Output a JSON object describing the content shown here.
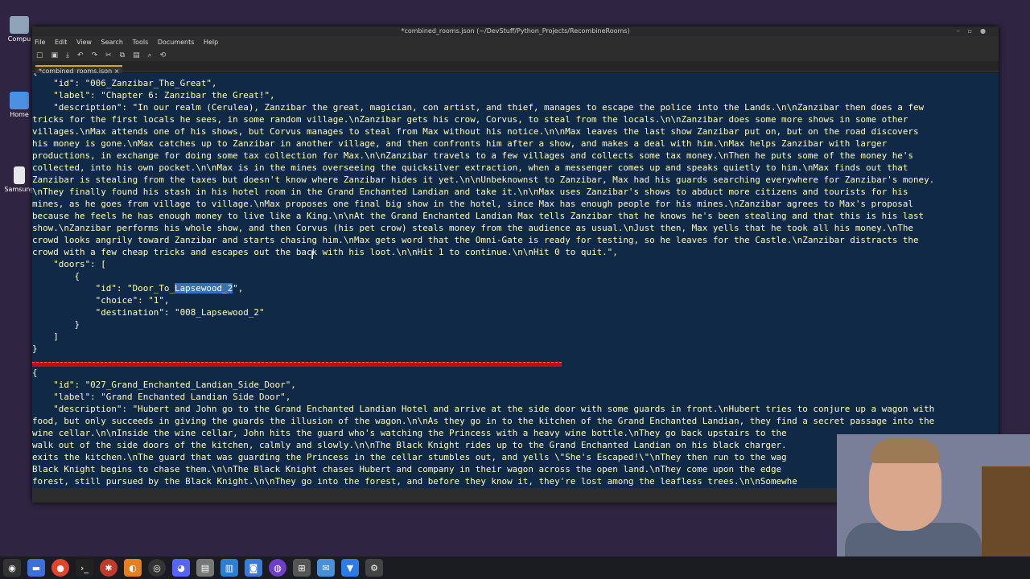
{
  "desktop": {
    "icons": [
      "Compu",
      "Home",
      "Samsung"
    ]
  },
  "window": {
    "title": "*combined_rooms.json (~/DevStuff/Python_Projects/RecombineRooms)",
    "menus": [
      "File",
      "Edit",
      "View",
      "Search",
      "Tools",
      "Documents",
      "Help"
    ],
    "tab_label": "*combined_rooms.json",
    "tab_close": "×"
  },
  "editor": {
    "l0": "{",
    "l1": "    \"id\": \"006_Zanzibar_The_Great\",",
    "l2": "    \"label\": \"Chapter 6: Zanzibar the Great!\",",
    "l3": "    \"description\": \"In our realm (Cerulea), Zanzibar the great, magician, con artist, and thief, manages to escape the police into the Lands.\\n\\nZanzibar then does a few",
    "l4": "tricks for the first locals he sees, in some random village.\\nZanzibar gets his crow, Corvus, to steal from the locals.\\n\\nZanzibar does some more shows in some other",
    "l5": "villages.\\nMax attends one of his shows, but Corvus manages to steal from Max without his notice.\\n\\nMax leaves the last show Zanzibar put on, but on the road discovers",
    "l6": "his money is gone.\\nMax catches up to Zanzibar in another village, and then confronts him after a show, and makes a deal with him.\\nMax helps Zanzibar with larger",
    "l7": "productions, in exchange for doing some tax collection for Max.\\n\\nZanzibar travels to a few villages and collects some tax money.\\nThen he puts some of the money he's",
    "l8": "collected, into his own pocket.\\n\\nMax is in the mines overseeing the quicksilver extraction, when a messenger comes up and speaks quietly to him.\\nMax finds out that",
    "l9": "Zanzibar is stealing from the taxes but doesn't know where Zanzibar hides it yet.\\n\\nUnbeknownst to Zanzibar, Max had his guards searching everywhere for Zanzibar's money.",
    "l10": "\\nThey finally found his stash in his hotel room in the Grand Enchanted Landian and take it.\\n\\nMax uses Zanzibar's shows to abduct more citizens and tourists for his",
    "l11": "mines, as he goes from village to village.\\nMax proposes one final big show in the hotel, since Max has enough people for his mines.\\nZanzibar agrees to Max's proposal",
    "l12": "because he feels he has enough money to live like a King.\\n\\nAt the Grand Enchanted Landian Max tells Zanzibar that he knows he's been stealing and that this is his last",
    "l13": "show.\\nZanzibar performs his whole show, and then Corvus (his pet crow) steals money from the audience as usual.\\nJust then, Max yells that he took all his money.\\nThe",
    "l14": "crowd looks angrily toward Zanzibar and starts chasing him.\\nMax gets word that the Omni-Gate is ready for testing, so he leaves for the Castle.\\nZanzibar distracts the",
    "l15": "crowd with a few cheap tricks and escapes out the back with his loot.\\n\\nHit 1 to continue.\\n\\nHit 0 to quit.\",",
    "l16": "    \"doors\": [",
    "l17": "        {",
    "l18a": "            \"id\": \"Door_To_",
    "l18sel": "Lapsewood_2",
    "l18b": "\",",
    "l19": "            \"choice\": \"1\",",
    "l20": "            \"destination\": \"008_Lapsewood_2\"",
    "l21": "        }",
    "l22": "    ]",
    "l23": "}",
    "l24": "{",
    "l25": "    \"id\": \"027_Grand_Enchanted_Landian_Side_Door\",",
    "l26": "    \"label\": \"Grand Enchanted Landian Side Door\",",
    "l27": "    \"description\": \"Hubert and John go to the Grand Enchanted Landian Hotel and arrive at the side door with some guards in front.\\nHubert tries to conjure up a wagon with",
    "l28": "food, but only succeeds in giving the guards the illusion of the wagon.\\n\\nAs they go in to the kitchen of the Grand Enchanted Landian, they find a secret passage into the",
    "l29": "wine cellar.\\n\\nInside the wine cellar, John hits the guard who's watching the Princess with a heavy wine bottle.\\nThey go back upstairs to the",
    "l30": "walk out of the side doors of the kitchen, calmly and slowly.\\n\\nThe Black Knight rides up to the Grand Enchanted Landian on his black charger.",
    "l31": "exits the kitchen.\\nThe guard that was guarding the Princess in the cellar stumbles out, and yells \\\"She's Escaped!\\\"\\nThey then run to the wag",
    "l32": "Black Knight begins to chase them.\\n\\nThe Black Knight chases Hubert and company in their wagon across the open land.\\nThey come upon the edge",
    "l33": "forest, still pursued by the Black Knight.\\n\\nThey go into the forest, and before they know it, they're lost among the leafless trees.\\n\\nSomewhe"
  },
  "colors": {
    "editor_bg": "#0f2947",
    "text": "#fffdbf",
    "separator": "#c01010",
    "selection": "#3a6fb5"
  },
  "taskbar": {
    "icons": [
      "menu-icon",
      "folder-icon",
      "browser-icon",
      "terminal-icon",
      "game-icon",
      "blender-icon",
      "obs-icon",
      "discord-icon",
      "editor-icon",
      "files-icon",
      "camera-icon",
      "github-icon",
      "vscode-icon",
      "mail-icon",
      "app-icon",
      "settings-icon"
    ]
  }
}
